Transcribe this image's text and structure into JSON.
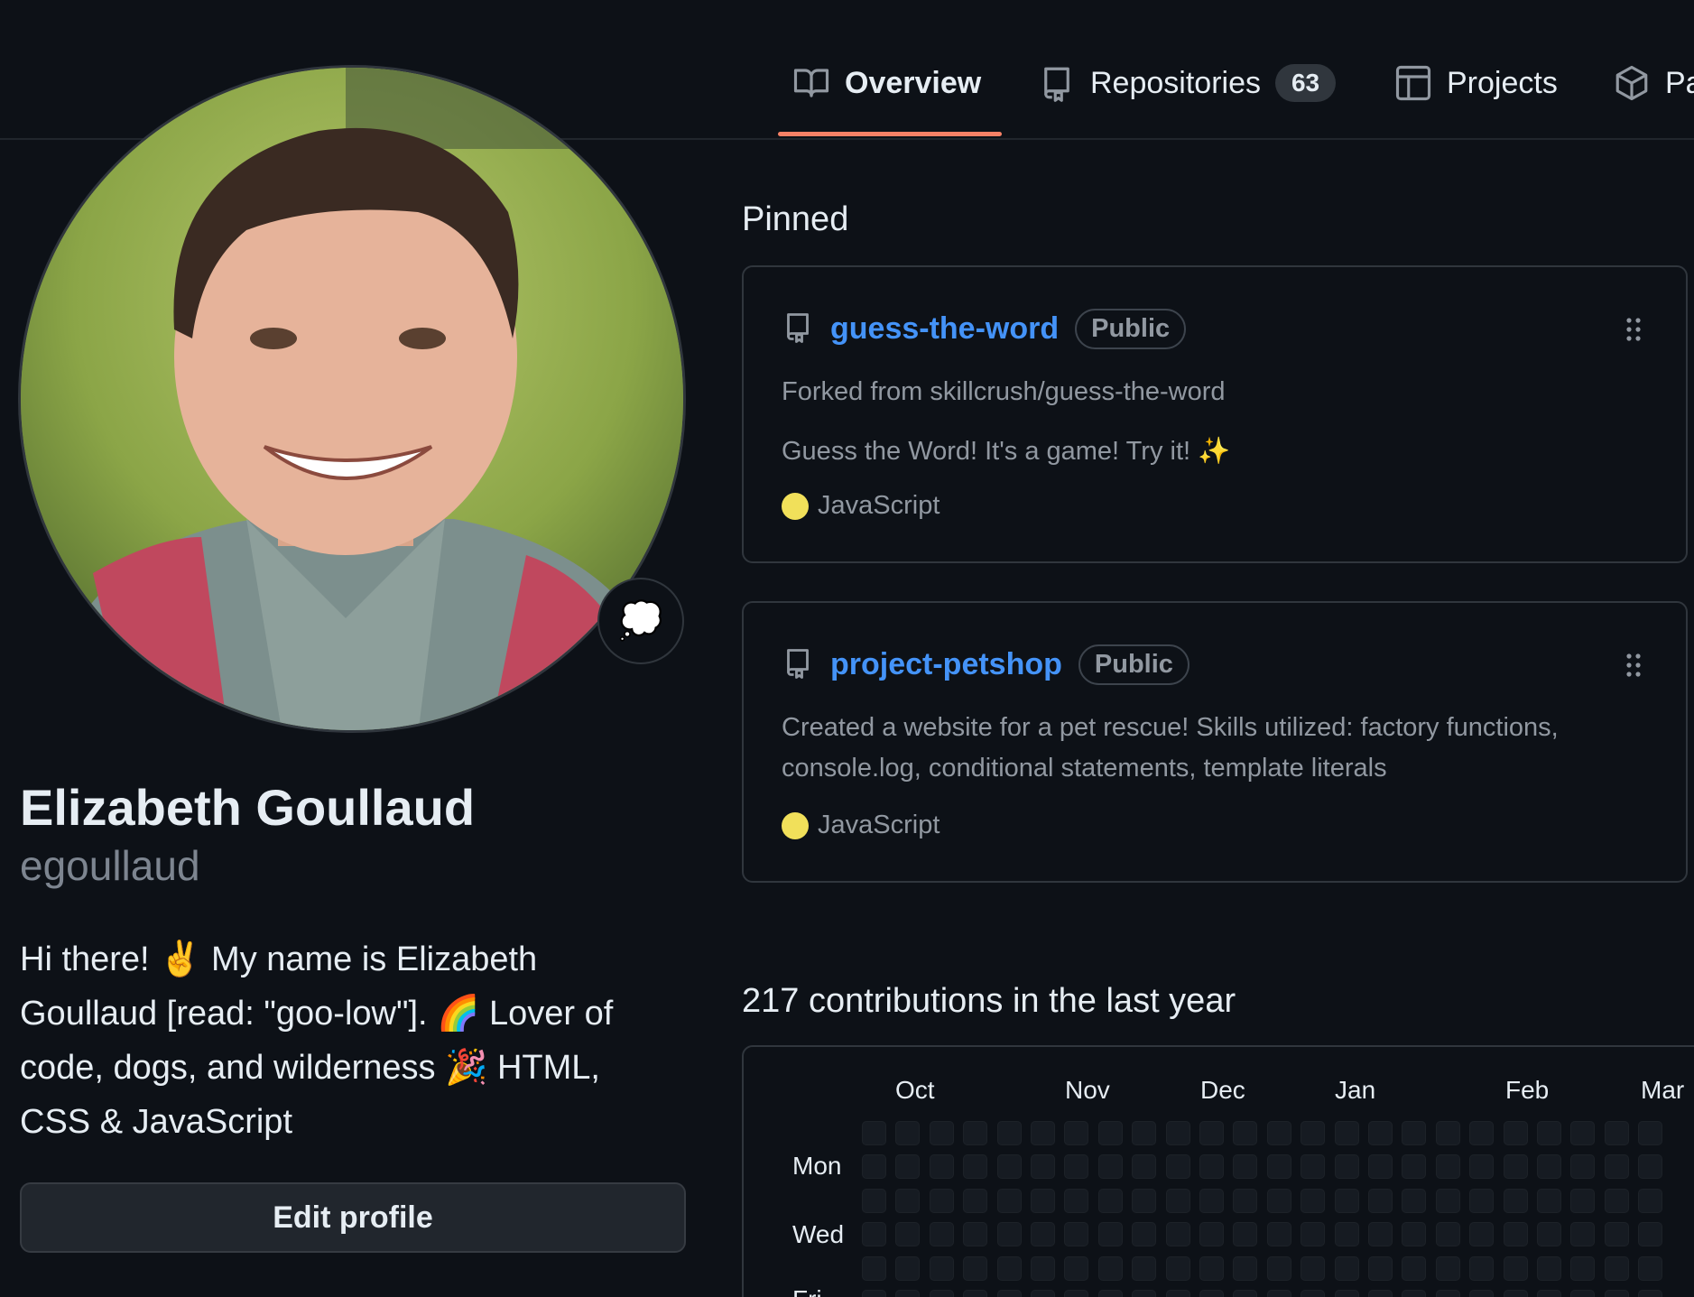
{
  "nav": {
    "tabs": [
      {
        "label": "Overview",
        "icon": "book-icon",
        "active": true
      },
      {
        "label": "Repositories",
        "icon": "repo-icon",
        "count": "63"
      },
      {
        "label": "Projects",
        "icon": "table-icon"
      },
      {
        "label": "Pa",
        "icon": "package-icon"
      }
    ]
  },
  "profile": {
    "name": "Elizabeth Goullaud",
    "username": "egoullaud",
    "status_emoji": "💭",
    "bio_lines": [
      "Hi there! ✌️ My name is Elizabeth",
      "Goullaud [read: \"goo-low\"]. 🌈  Lover of",
      "code, dogs, and wilderness 🎉  HTML,",
      "CSS & JavaScript"
    ],
    "edit_button": "Edit profile"
  },
  "pinned": {
    "title": "Pinned",
    "repos": [
      {
        "name": "guess-the-word",
        "visibility": "Public",
        "forked_from": "Forked from skillcrush/guess-the-word",
        "description": [
          "Guess the Word! It's a game! Try it! ✨"
        ],
        "language": "JavaScript",
        "language_color": "#f1e05a"
      },
      {
        "name": "project-petshop",
        "visibility": "Public",
        "description": [
          "Created a website for a pet rescue! Skills utilized: factory functions,",
          "console.log, conditional statements, template literals"
        ],
        "language": "JavaScript",
        "language_color": "#f1e05a"
      }
    ]
  },
  "contributions": {
    "title": "217 contributions in the last year",
    "months": [
      "Oct",
      "Nov",
      "Dec",
      "Jan",
      "Feb",
      "Mar"
    ],
    "day_labels": [
      "Mon",
      "Wed",
      "Fri"
    ]
  },
  "colors": {
    "background": "#0d1117",
    "accent_underline": "#f78166",
    "link": "#4493f8",
    "muted_text": "#9198a1",
    "empty_cell": "#161b22"
  }
}
